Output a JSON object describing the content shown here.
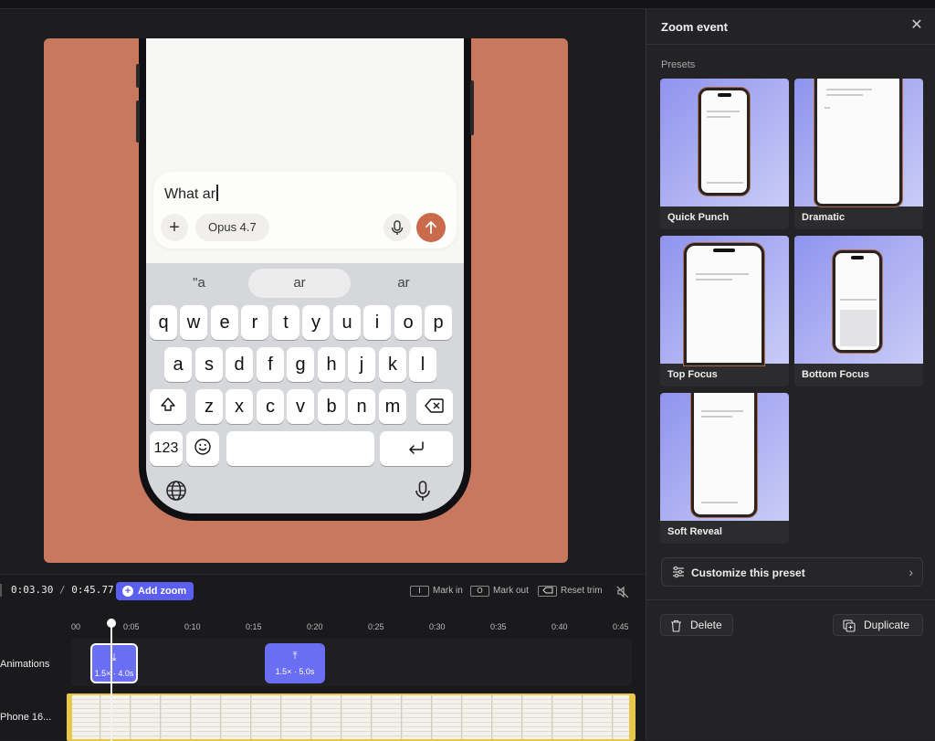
{
  "editor": {
    "composer_text": "What ar",
    "model_label": "Opus 4.7",
    "suggestions": [
      "\"a",
      "ar",
      "ar"
    ],
    "keyboard_rows": [
      [
        "q",
        "w",
        "e",
        "r",
        "t",
        "y",
        "u",
        "i",
        "o",
        "p"
      ],
      [
        "a",
        "s",
        "d",
        "f",
        "g",
        "h",
        "j",
        "k",
        "l"
      ],
      [
        "z",
        "x",
        "c",
        "v",
        "b",
        "n",
        "m"
      ]
    ],
    "numbers_key": "123"
  },
  "panel": {
    "title": "Zoom event",
    "presets_label": "Presets",
    "presets": [
      {
        "name": "Quick Punch"
      },
      {
        "name": "Dramatic"
      },
      {
        "name": "Top Focus"
      },
      {
        "name": "Bottom Focus"
      },
      {
        "name": "Soft Reveal"
      }
    ],
    "customize_label": "Customize this preset",
    "delete_label": "Delete",
    "duplicate_label": "Duplicate"
  },
  "timeline": {
    "current_time": "0:03.30",
    "separator": "/",
    "total_time": "0:45.77",
    "add_zoom_label": "Add zoom",
    "mark_in_key": "I",
    "mark_in_label": "Mark in",
    "mark_out_key": "O",
    "mark_out_label": "Mark out",
    "reset_trim_label": "Reset trim",
    "ruler_ticks": [
      "00",
      "0:05",
      "0:10",
      "0:15",
      "0:20",
      "0:25",
      "0:30",
      "0:35",
      "0:40",
      "0:45"
    ],
    "tracks": {
      "animations_label": "Animations",
      "video_label": "Phone 16..."
    },
    "clips": [
      {
        "text": "1.5× · 4.0s"
      },
      {
        "text": "1.5× · 5.0s"
      }
    ]
  },
  "colors": {
    "accent": "#5b5ff0",
    "backdrop": "#c8785e",
    "send": "#c96a4a",
    "trim": "#e8c84a"
  }
}
